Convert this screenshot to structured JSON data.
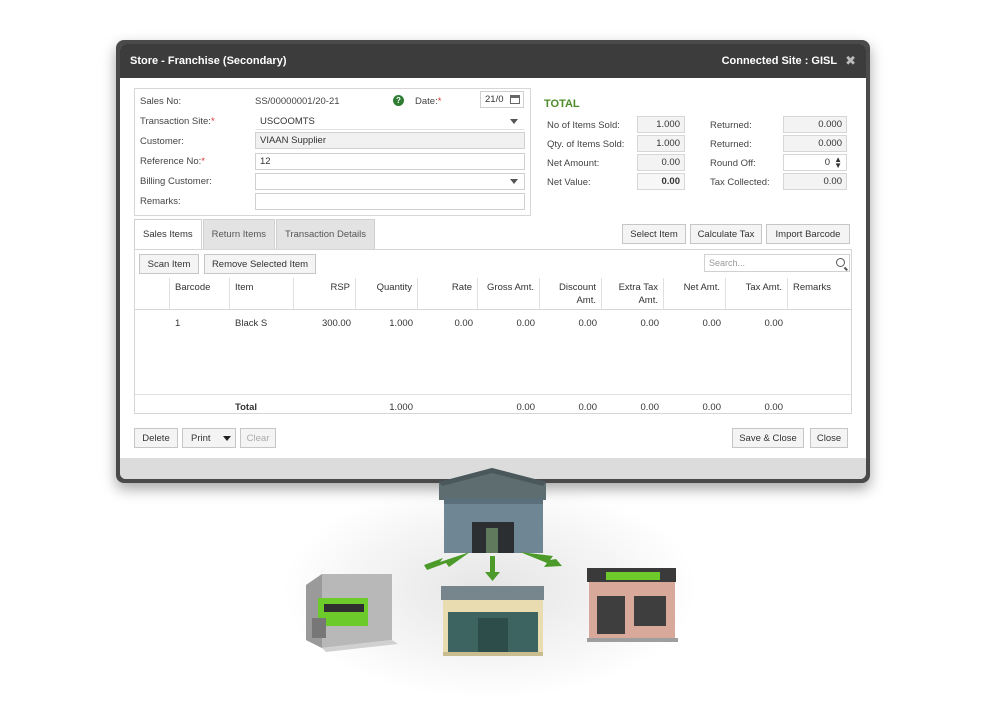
{
  "window": {
    "title": "Store - Franchise (Secondary)",
    "connected_site": "Connected Site : GISL"
  },
  "form": {
    "sales_no_label": "Sales No:",
    "sales_no_value": "SS/00000001/20-21",
    "date_label": "Date:",
    "date_value": "21/0",
    "transaction_site_label": "Transaction Site:",
    "transaction_site_value": "USCOOMTS",
    "customer_label": "Customer:",
    "customer_value": "VIAAN Supplier",
    "reference_no_label": "Reference No:",
    "reference_no_value": "12",
    "billing_customer_label": "Billing Customer:",
    "billing_customer_value": "",
    "remarks_label": "Remarks:",
    "remarks_value": "",
    "required_mark": "*"
  },
  "totals": {
    "title": "TOTAL",
    "items_sold_label": "No of Items Sold:",
    "items_sold_value": "1.000",
    "returned1_label": "Returned:",
    "returned1_value": "0.000",
    "qty_sold_label": "Qty. of Items Sold:",
    "qty_sold_value": "1.000",
    "returned2_label": "Returned:",
    "returned2_value": "0.000",
    "net_amount_label": "Net Amount:",
    "net_amount_value": "0.00",
    "round_off_label": "Round Off:",
    "round_off_value": "0",
    "net_value_label": "Net Value:",
    "net_value_value": "0.00",
    "tax_collected_label": "Tax Collected:",
    "tax_collected_value": "0.00"
  },
  "tabs": [
    "Sales Items",
    "Return Items",
    "Transaction Details"
  ],
  "toolbar": {
    "select_item": "Select Item",
    "calculate_tax": "Calculate Tax",
    "import_barcode": "Import Barcode",
    "scan_item": "Scan Item",
    "remove_selected": "Remove Selected Item",
    "search_placeholder": "Search..."
  },
  "grid": {
    "columns": [
      "Barcode",
      "Item",
      "RSP",
      "Quantity",
      "Rate",
      "Gross Amt.",
      "Discount Amt.",
      "Extra Tax Amt.",
      "Net Amt.",
      "Tax Amt.",
      "Remarks"
    ],
    "rows": [
      {
        "barcode": "1",
        "item": "Black S",
        "rsp": "300.00",
        "quantity": "1.000",
        "rate": "0.00",
        "gross": "0.00",
        "discount": "0.00",
        "extra_tax": "0.00",
        "net": "0.00",
        "tax": "0.00",
        "remarks": ""
      }
    ],
    "total": {
      "label": "Total",
      "quantity": "1.000",
      "gross": "0.00",
      "discount": "0.00",
      "extra_tax": "0.00",
      "net": "0.00",
      "tax": "0.00"
    }
  },
  "footer": {
    "delete": "Delete",
    "print": "Print",
    "clear": "Clear",
    "save_close": "Save & Close",
    "close": "Close"
  },
  "colors": {
    "titlebar": "#3c3c3c",
    "accent_green": "#4e8b2a",
    "store_green": "#6ccb2b"
  }
}
